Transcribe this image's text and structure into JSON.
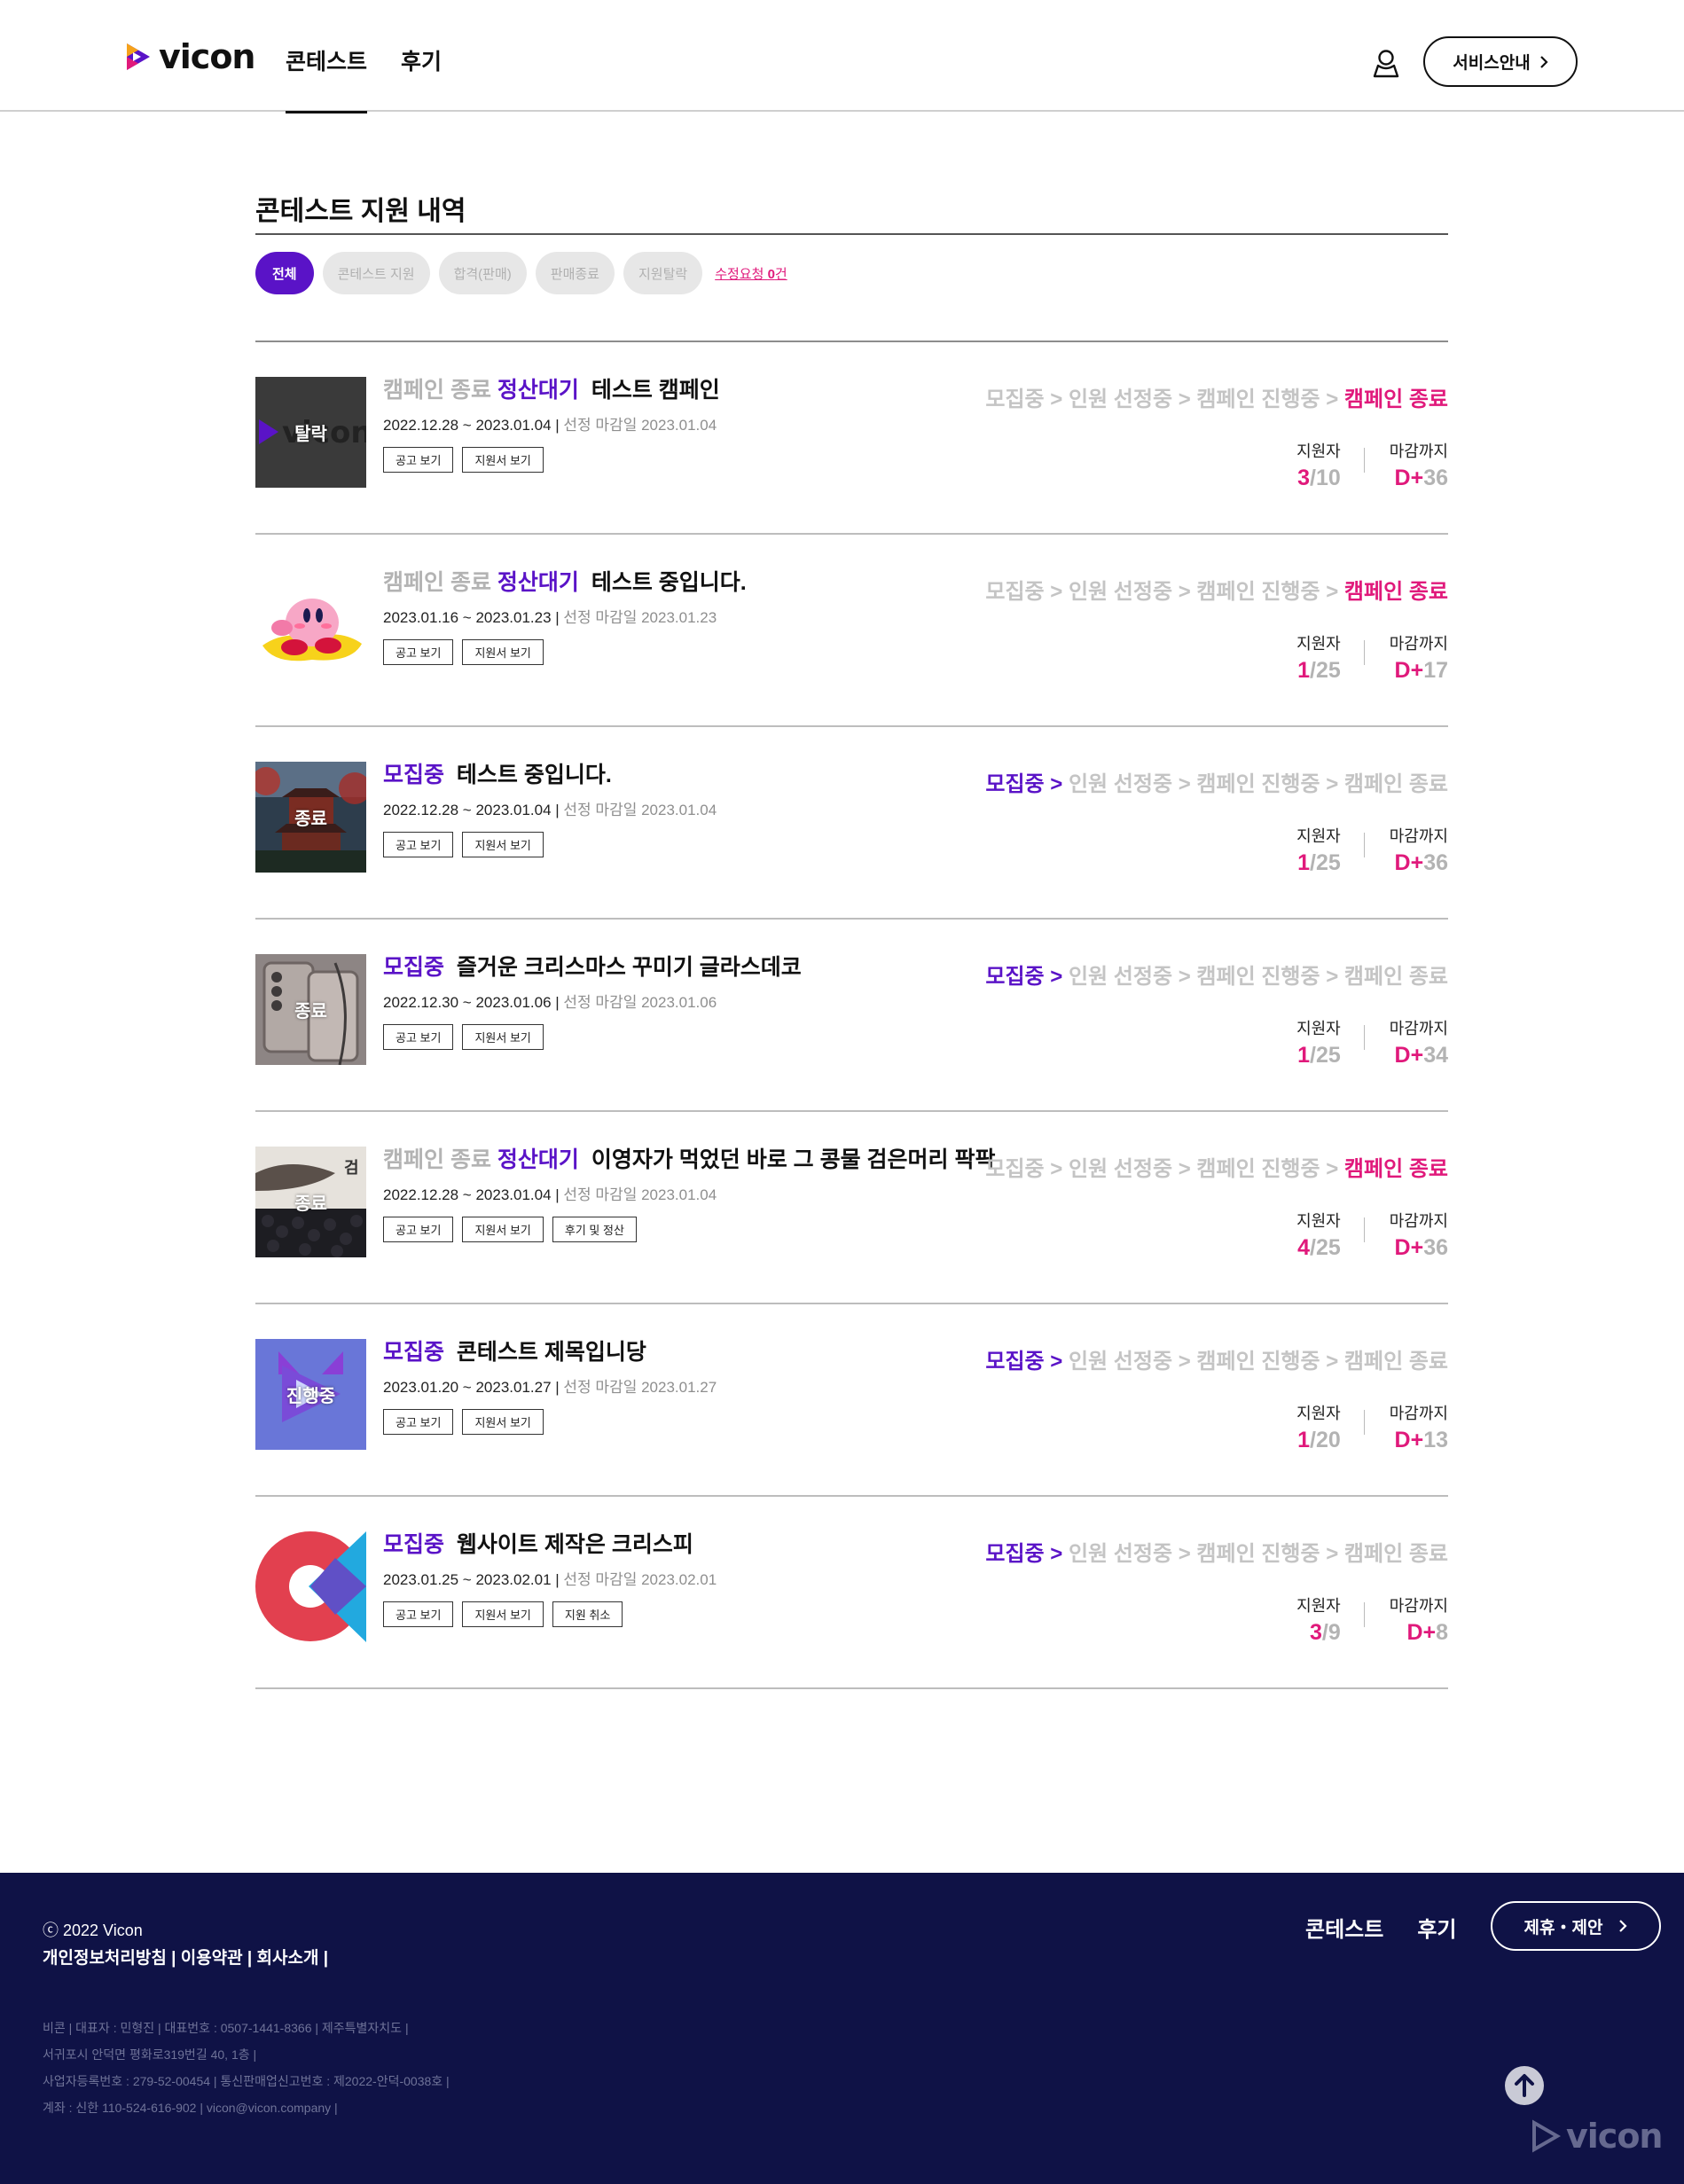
{
  "header": {
    "logo_text": "vicon",
    "nav": [
      "콘테스트",
      "후기"
    ],
    "service_button": "서비스안내"
  },
  "page": {
    "title": "콘테스트 지원 내역",
    "filters": [
      "전체",
      "콘테스트 지원",
      "합격(판매)",
      "판매종료",
      "지원탈락"
    ],
    "request_link_prefix": "수정요청 ",
    "request_count": "0",
    "request_link_suffix": "건"
  },
  "labels": {
    "applicants": "지원자",
    "until_deadline": "마감까지",
    "deadline_prefix": "선정 마감일",
    "steps": [
      "모집중",
      "인원 선정중",
      "캠페인 진행중",
      "캠페인 종료"
    ],
    "arrow": ">"
  },
  "rows": [
    {
      "status1": "캠페인 종료",
      "status2": "정산대기",
      "title": "테스트 캠페인",
      "period": "2022.12.28 ~ 2023.01.04",
      "deadline": "2023.01.04",
      "buttons": [
        "공고 보기",
        "지원서 보기"
      ],
      "thumb_label": "탈락",
      "thumb": "vicon-dark",
      "applied": "3",
      "capacity": "10",
      "dday": "36",
      "current_step": 4
    },
    {
      "status1": "캠페인 종료",
      "status2": "정산대기",
      "title": "테스트 중입니다.",
      "period": "2023.01.16 ~ 2023.01.23",
      "deadline": "2023.01.23",
      "buttons": [
        "공고 보기",
        "지원서 보기"
      ],
      "thumb_label": "",
      "thumb": "kirby",
      "applied": "1",
      "capacity": "25",
      "dday": "17",
      "current_step": 4
    },
    {
      "status1": "모집중",
      "status2": "",
      "title": "테스트 중입니다.",
      "period": "2022.12.28 ~ 2023.01.04",
      "deadline": "2023.01.04",
      "buttons": [
        "공고 보기",
        "지원서 보기"
      ],
      "thumb_label": "종료",
      "thumb": "temple",
      "applied": "1",
      "capacity": "25",
      "dday": "36",
      "current_step": 1
    },
    {
      "status1": "모집중",
      "status2": "",
      "title": "즐거운 크리스마스 꾸미기 글라스데코",
      "period": "2022.12.30 ~ 2023.01.06",
      "deadline": "2023.01.06",
      "buttons": [
        "공고 보기",
        "지원서 보기"
      ],
      "thumb_label": "종료",
      "thumb": "phone",
      "applied": "1",
      "capacity": "25",
      "dday": "34",
      "current_step": 1
    },
    {
      "status1": "캠페인 종료",
      "status2": "정산대기",
      "title": "이영자가 먹었던 바로 그 콩물 검은머리 팍팍",
      "period": "2022.12.28 ~ 2023.01.04",
      "deadline": "2023.01.04",
      "buttons": [
        "공고 보기",
        "지원서 보기",
        "후기 및 정산"
      ],
      "thumb_label": "종료",
      "thumb": "beans",
      "applied": "4",
      "capacity": "25",
      "dday": "36",
      "current_step": 4
    },
    {
      "status1": "모집중",
      "status2": "",
      "title": "콘테스트 제목입니당",
      "period": "2023.01.20 ~ 2023.01.27",
      "deadline": "2023.01.27",
      "buttons": [
        "공고 보기",
        "지원서 보기"
      ],
      "thumb_label": "진행중",
      "thumb": "purple",
      "applied": "1",
      "capacity": "20",
      "dday": "13",
      "current_step": 1
    },
    {
      "status1": "모집중",
      "status2": "",
      "title": "웹사이트 제작은 크리스피",
      "period": "2023.01.25 ~ 2023.02.01",
      "deadline": "2023.02.01",
      "buttons": [
        "공고 보기",
        "지원서 보기",
        "지원 취소"
      ],
      "thumb_label": "",
      "thumb": "crispy",
      "applied": "3",
      "capacity": "9",
      "dday": "8",
      "current_step": 1
    }
  ],
  "footer": {
    "copyright": "ⓒ 2022 Vicon",
    "links": "개인정보처리방침 | 이용약관 | 회사소개 |",
    "info": [
      "비콘 | 대표자 : 민형진 | 대표번호 : 0507-1441-8366 | 제주특별자치도 |",
      "서귀포시 안덕면 평화로319번길 40, 1층 |",
      "사업자등록번호 : 279-52-00454 | 통신판매업신고번호 : 제2022-안덕-0038호 |",
      "계좌 : 신한 110-524-616-902 | vicon@vicon.company |"
    ],
    "nav": [
      "콘테스트",
      "후기"
    ],
    "partner_button": "제휴・제안",
    "logo_text": "vicon"
  },
  "colors": {
    "brand_purple": "#5a13c7",
    "accent_pink": "#e0197b",
    "footer_bg": "#0f1246"
  }
}
